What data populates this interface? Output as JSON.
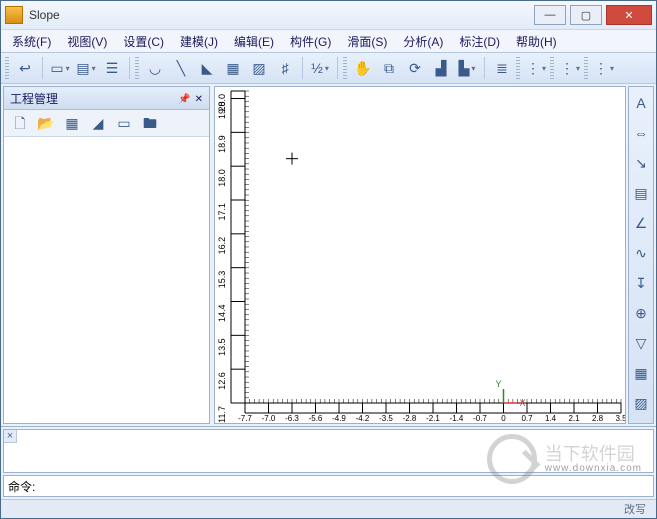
{
  "title": "Slope",
  "menu": [
    "系统(F)",
    "视图(V)",
    "设置(C)",
    "建模(J)",
    "编辑(E)",
    "构件(G)",
    "滑面(S)",
    "分析(A)",
    "标注(D)",
    "帮助(H)"
  ],
  "side": {
    "title": "工程管理"
  },
  "cmd": {
    "label": "命令:"
  },
  "status": {
    "right": "改写"
  },
  "watermark": {
    "text": "当下软件园",
    "sub": "www.downxia.com"
  },
  "chart_data": {
    "type": "scatter",
    "title": "",
    "xlabel": "",
    "ylabel": "",
    "xlim": [
      -7.7,
      3.5
    ],
    "ylim": [
      11.7,
      20.0
    ],
    "x_ticks": [
      -7.7,
      -7.0,
      -6.3,
      -5.6,
      -4.9,
      -4.2,
      -3.5,
      -2.8,
      -2.1,
      -1.4,
      -0.7,
      0,
      0.7,
      1.4,
      2.1,
      2.8,
      3.5
    ],
    "y_ticks_outer": [
      11.7,
      12.6,
      13.5,
      14.4,
      15.3,
      16.2,
      17.1,
      18.0,
      18.9,
      19.8,
      20.0
    ],
    "origin_marker": {
      "x": 0,
      "y": 11.7,
      "xlabel": "X",
      "ylabel": "Y"
    },
    "cursor": {
      "x": -6.3,
      "y": 18.2
    },
    "series": []
  }
}
